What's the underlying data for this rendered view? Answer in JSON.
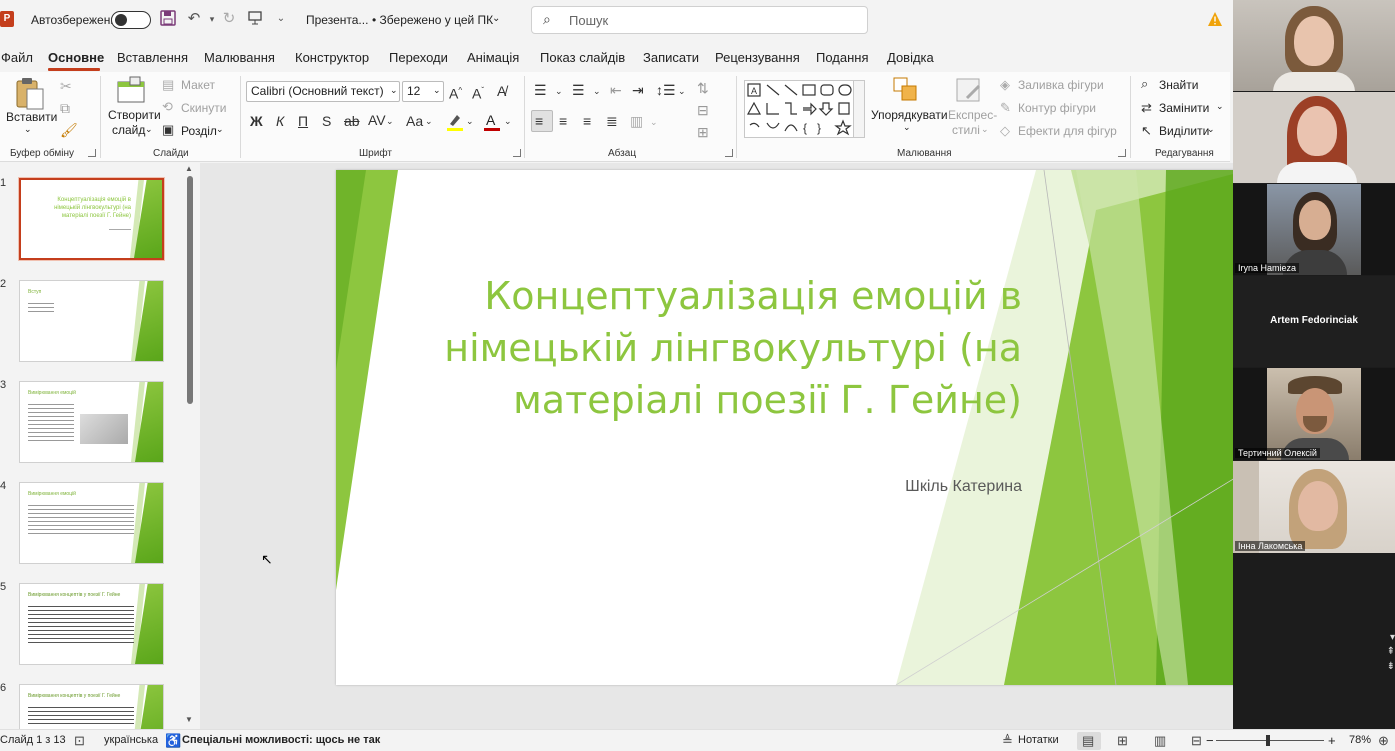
{
  "titlebar": {
    "autosave_label": "Автозбереження",
    "doc_name": "Презента...",
    "saved_state": "• Збережено у цей ПК",
    "search_placeholder": "Пошук"
  },
  "menu": [
    "Файл",
    "Основне",
    "Вставлення",
    "Малювання",
    "Конструктор",
    "Переходи",
    "Анімація",
    "Показ слайдів",
    "Записати",
    "Рецензування",
    "Подання",
    "Довідка"
  ],
  "ribbon": {
    "clipboard": {
      "paste": "Вставити",
      "label": "Буфер обміну"
    },
    "slides": {
      "new_slide_1": "Створити",
      "new_slide_2": "слайд",
      "layout": "Макет",
      "reset": "Скинути",
      "section": "Розділ",
      "label": "Слайди"
    },
    "font": {
      "name": "Calibri (Основний текст)",
      "size": "12",
      "label": "Шрифт"
    },
    "paragraph": {
      "label": "Абзац"
    },
    "drawing": {
      "arrange": "Упорядкувати",
      "quick_styles_1": "Експрес-",
      "quick_styles_2": "стилі",
      "shape_fill": "Заливка фігури",
      "shape_outline": "Контур фігури",
      "shape_effects": "Ефекти для фігур",
      "label": "Малювання"
    },
    "editing": {
      "find": "Знайти",
      "replace": "Замінити",
      "select": "Виділити",
      "label": "Редагування"
    }
  },
  "thumbnails": [
    {
      "num": "1",
      "title": "Концептуалізація емоцій в німецькій лінгвокультурі (на матеріалі поезії Г. Гейне)",
      "selected": true
    },
    {
      "num": "2",
      "title": "Вступ",
      "selected": false
    },
    {
      "num": "3",
      "title": "Вимірювання емоцій",
      "selected": false
    },
    {
      "num": "4",
      "title": "Вимірювання емоцій",
      "selected": false
    },
    {
      "num": "5",
      "title": "Вимірювання концептів у поезії Г. Гейне",
      "selected": false
    },
    {
      "num": "6",
      "title": "Вимірювання концептів у поезії Г. Гейне",
      "selected": false
    }
  ],
  "slide": {
    "title": "Концептуалізація емоцій в німецькій лінгвокультурі (на матеріалі поезії Г. Гейне)",
    "author": "Шкіль Катерина",
    "accent": "#8dc63f"
  },
  "status": {
    "slide_pos": "Слайд 1 з 13",
    "language": "українська",
    "accessibility": "Спеціальні можливості: щось не так",
    "notes": "Нотатки",
    "zoom": "78%"
  },
  "participants": [
    {
      "name": ""
    },
    {
      "name": ""
    },
    {
      "name": "Iryna Hamieza"
    },
    {
      "name": "Artem Fedorinciak"
    },
    {
      "name": "Тертичний Олексій"
    },
    {
      "name": "Інна  Лакомська"
    }
  ]
}
